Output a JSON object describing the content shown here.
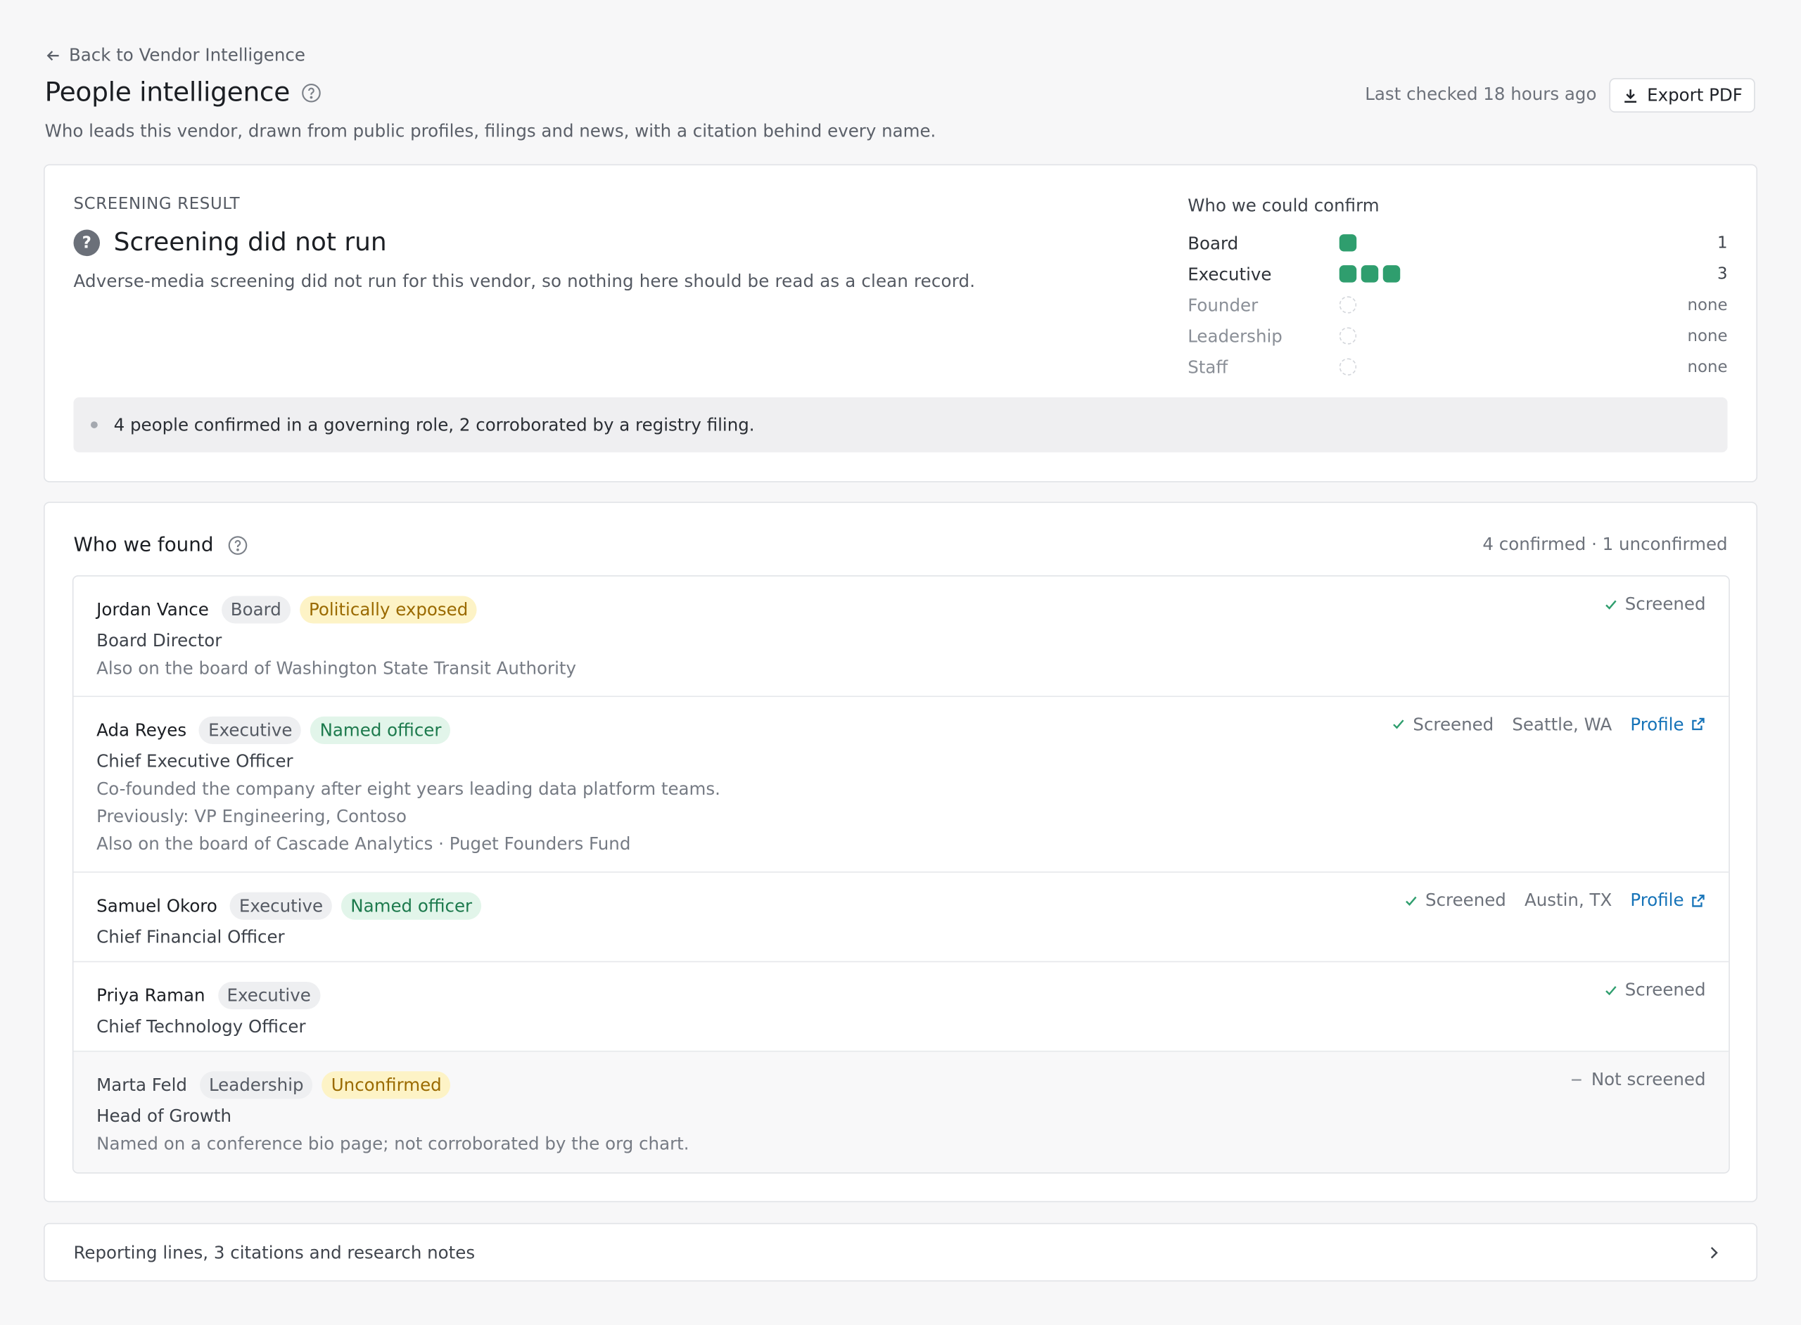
{
  "nav": {
    "back_label": "Back to Vendor Intelligence"
  },
  "header": {
    "title": "People intelligence",
    "subtitle": "Who leads this vendor, drawn from public profiles, filings and news, with a citation behind every name.",
    "last_checked": "Last checked 18 hours ago",
    "export_label": "Export PDF"
  },
  "screening": {
    "eyebrow": "SCREENING RESULT",
    "title": "Screening did not run",
    "description": "Adverse-media screening did not run for this vendor, so nothing here should be read as a clean record.",
    "summary": "4 people confirmed in a governing role, 2 corroborated by a registry filing."
  },
  "confirm": {
    "title": "Who we could confirm",
    "rows": [
      {
        "label": "Board",
        "count": 1,
        "count_label": "1"
      },
      {
        "label": "Executive",
        "count": 3,
        "count_label": "3"
      },
      {
        "label": "Founder",
        "count": 0,
        "count_label": "none"
      },
      {
        "label": "Leadership",
        "count": 0,
        "count_label": "none"
      },
      {
        "label": "Staff",
        "count": 0,
        "count_label": "none"
      }
    ],
    "dot_color": "#2f9e6e"
  },
  "found": {
    "title": "Who we found",
    "counts": "4 confirmed · 1 unconfirmed",
    "people": [
      {
        "name": "Jordan Vance",
        "role_badge": "Board",
        "flag": "Politically exposed",
        "title": "Board Director",
        "lines": [
          "Also on the board of Washington State Transit Authority"
        ],
        "status": "Screened"
      },
      {
        "name": "Ada Reyes",
        "role_badge": "Executive",
        "flag": "Named officer",
        "title": "Chief Executive Officer",
        "lines": [
          "Co-founded the company after eight years leading data platform teams.",
          "Previously: VP Engineering, Contoso",
          "Also on the board of Cascade Analytics · Puget Founders Fund"
        ],
        "status": "Screened",
        "location": "Seattle, WA",
        "profile": "Profile"
      },
      {
        "name": "Samuel Okoro",
        "role_badge": "Executive",
        "flag": "Named officer",
        "title": "Chief Financial Officer",
        "status": "Screened",
        "location": "Austin, TX",
        "profile": "Profile"
      },
      {
        "name": "Priya Raman",
        "role_badge": "Executive",
        "title": "Chief Technology Officer",
        "status": "Screened"
      },
      {
        "name": "Marta Feld",
        "role_badge": "Leadership",
        "flag": "Unconfirmed",
        "title": "Head of Growth",
        "lines": [
          "Named on a conference bio page; not corroborated by the org chart."
        ],
        "status": "Not screened"
      }
    ]
  },
  "notes": {
    "label": "Reporting lines, 3 citations and research notes"
  }
}
